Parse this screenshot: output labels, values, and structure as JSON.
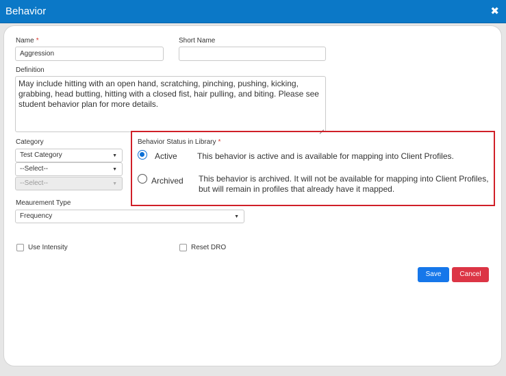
{
  "dialog": {
    "title": "Behavior",
    "close_glyph": "✖"
  },
  "form": {
    "name_label": "Name",
    "required_mark": "*",
    "name_value": "Aggression",
    "short_name_label": "Short Name",
    "short_name_value": "",
    "definition_label": "Definition",
    "definition_value": "May include hitting with an open hand, scratching, pinching, pushing, kicking, grabbing, head butting, hitting with a closed fist, hair pulling, and biting.  Please see student behavior plan for more details.",
    "category_label": "Category",
    "category_selects": [
      "Test Category",
      "--Select--",
      "--Select--"
    ],
    "measurement_label": "Meaurement Type",
    "measurement_value": "Frequency",
    "use_intensity_label": "Use Intensity",
    "reset_dro_label": "Reset DRO",
    "caret": "▼"
  },
  "status": {
    "label": "Behavior Status in Library",
    "selected": "Active",
    "options": [
      {
        "label": "Active",
        "description": "This behavior is active and is available for mapping into Client Profiles."
      },
      {
        "label": "Archived",
        "description": "This behavior is archived. It will not be available for mapping into Client Profiles, but will remain in profiles that already have it mapped."
      }
    ],
    "highlight_color": "#d01f27"
  },
  "buttons": {
    "save_label": "Save",
    "cancel_label": "Cancel"
  },
  "colors": {
    "title_bar": "#0b78c7",
    "primary": "#1677ea",
    "danger": "#dc3545",
    "radio_checked": "#0b6fd6"
  }
}
